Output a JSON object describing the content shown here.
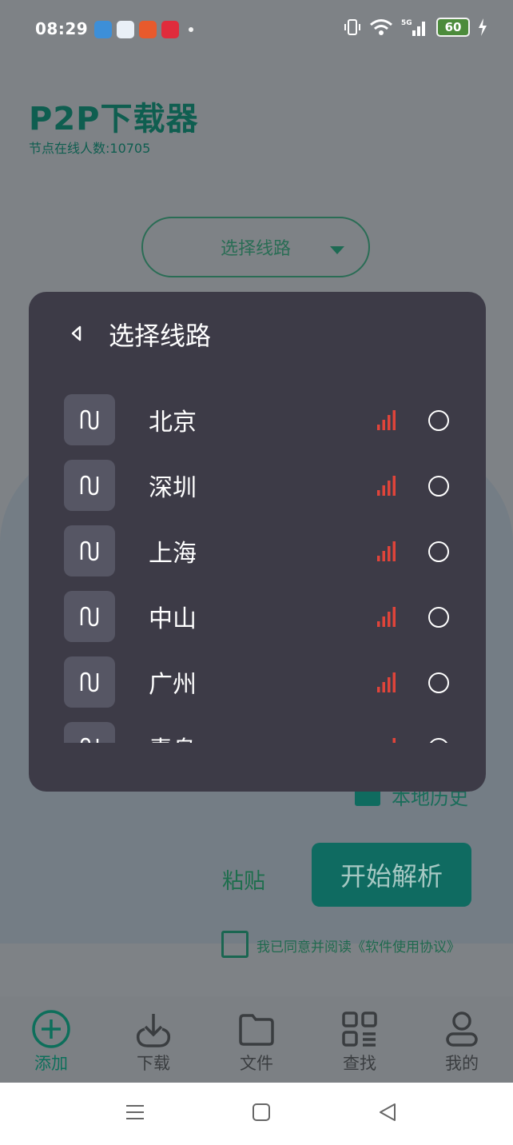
{
  "status_bar": {
    "time": "08:29",
    "battery": "60"
  },
  "app": {
    "title": "P2P下载器",
    "online_count": "节点在线人数:10705",
    "route_selector_label": "选择线路",
    "history_label": "本地历史",
    "paste_label": "粘贴",
    "start_label": "开始解析",
    "agreement_text": "我已同意并阅读《软件使用协议》"
  },
  "modal": {
    "title": "选择线路",
    "routes": [
      {
        "city": "北京",
        "signal_color": "#e0443a"
      },
      {
        "city": "深圳",
        "signal_color": "#e0443a"
      },
      {
        "city": "上海",
        "signal_color": "#e0443a"
      },
      {
        "city": "中山",
        "signal_color": "#e0443a"
      },
      {
        "city": "广州",
        "signal_color": "#e0443a"
      },
      {
        "city": "青岛",
        "signal_color": "#e0443a"
      }
    ]
  },
  "tabs": [
    {
      "label": "添加",
      "icon": "plus-circle-icon",
      "active": true
    },
    {
      "label": "下载",
      "icon": "download-icon",
      "active": false
    },
    {
      "label": "文件",
      "icon": "folder-icon",
      "active": false
    },
    {
      "label": "查找",
      "icon": "grid-search-icon",
      "active": false
    },
    {
      "label": "我的",
      "icon": "user-icon",
      "active": false
    }
  ],
  "colors": {
    "accent": "#0f6b61",
    "modal_bg": "#3d3b47",
    "signal": "#e0443a"
  }
}
